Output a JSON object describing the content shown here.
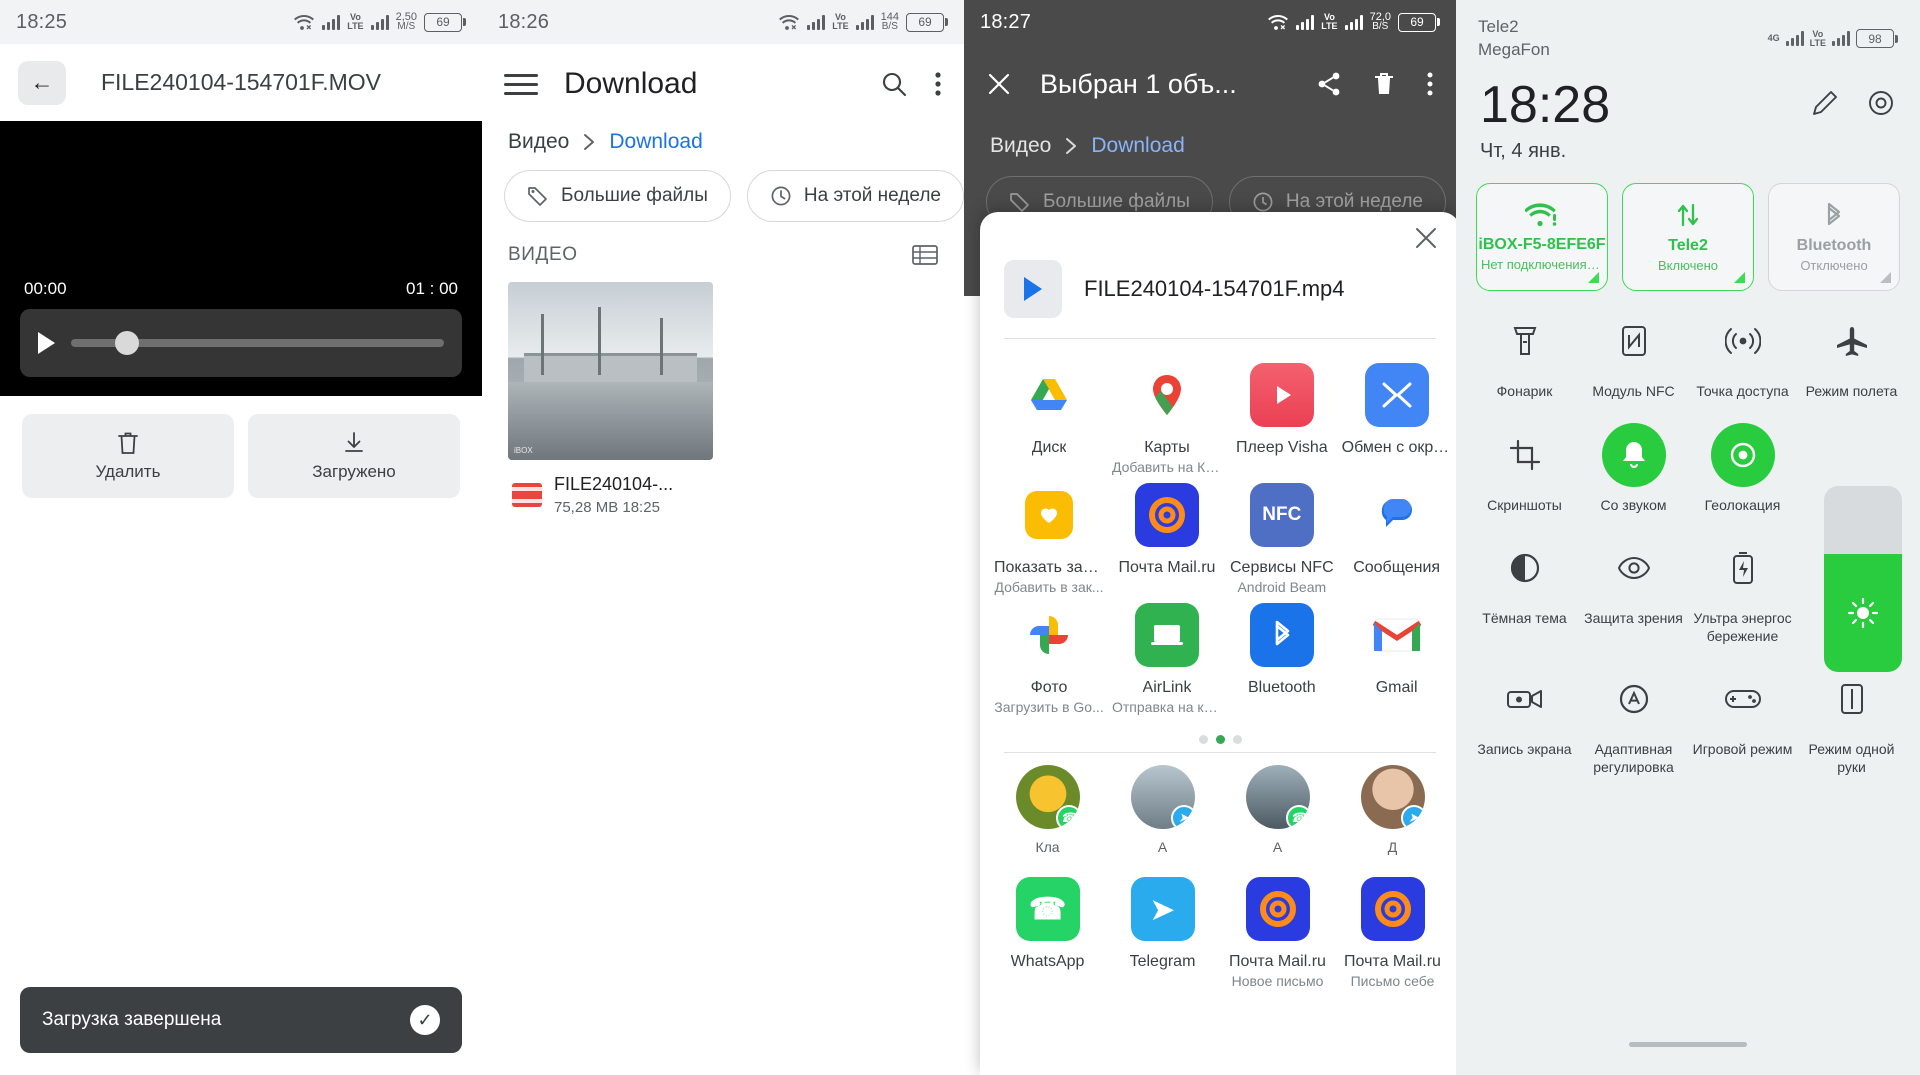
{
  "panel1": {
    "status": {
      "time": "18:25",
      "wifi": "wifi-off-icon",
      "volte": "Vo LTE",
      "netspeed_value": "2,50",
      "netspeed_unit": "M/S",
      "battery": "69"
    },
    "appbar": {
      "back_icon": "arrow-left-icon",
      "title": "FILE240104-154701F.MOV"
    },
    "player": {
      "current_time": "00:00",
      "duration": "01 : 00",
      "play_icon": "play-icon"
    },
    "actions": [
      {
        "icon": "trash-icon",
        "label": "Удалить"
      },
      {
        "icon": "download-icon",
        "label": "Загружено"
      }
    ],
    "snackbar": {
      "text": "Загрузка завершена",
      "icon": "check-circle-icon"
    }
  },
  "panel2": {
    "status": {
      "time": "18:26",
      "volte": "Vo LTE",
      "netspeed_value": "144",
      "netspeed_unit": "B/S",
      "battery": "69"
    },
    "appbar": {
      "menu_icon": "hamburger-icon",
      "title": "Download",
      "search_icon": "search-icon",
      "overflow_icon": "more-vert-icon"
    },
    "breadcrumb": {
      "root": "Видео",
      "sep": "chevron-right-icon",
      "current": "Download"
    },
    "chips": [
      {
        "icon": "tag-icon",
        "label": "Большие файлы"
      },
      {
        "icon": "history-icon",
        "label": "На этой неделе"
      }
    ],
    "section": {
      "header": "ВИДЕО",
      "view_icon": "list-view-icon"
    },
    "file": {
      "name": "FILE240104-...",
      "meta": "75,28 MB 18:25",
      "icon": "video-file-icon"
    }
  },
  "panel3": {
    "status": {
      "time": "18:27",
      "volte": "Vo LTE",
      "netspeed_value": "72,0",
      "netspeed_unit": "B/S",
      "battery": "69"
    },
    "appbar": {
      "close_icon": "close-icon",
      "title": "Выбран 1 объ...",
      "share_icon": "share-icon",
      "delete_icon": "trash-icon",
      "overflow_icon": "more-vert-icon"
    },
    "breadcrumb": {
      "root": "Видео",
      "sep": "chevron-right-icon",
      "current": "Download"
    },
    "chips": [
      {
        "icon": "tag-icon",
        "label": "Большие файлы"
      },
      {
        "icon": "history-icon",
        "label": "На этой неделе"
      }
    ],
    "sheet": {
      "close_icon": "close-icon",
      "file_icon": "play-icon",
      "file_name": "FILE240104-154701F.mp4",
      "apps": [
        {
          "label": "Диск",
          "sub": "",
          "icon": "google-drive-icon"
        },
        {
          "label": "Карты",
          "sub": "Добавить на Ка...",
          "icon": "google-maps-icon"
        },
        {
          "label": "Плеер Visha",
          "sub": "",
          "icon": "visha-player-icon"
        },
        {
          "label": "Обмен с окруже...",
          "sub": "",
          "icon": "nearby-share-icon"
        },
        {
          "label": "Показать заклад...",
          "sub": "Добавить в зак...",
          "icon": "bookmark-heart-icon"
        },
        {
          "label": "Почта Mail.ru",
          "sub": "",
          "icon": "mailru-icon",
          "has_caret": true
        },
        {
          "label": "Сервисы NFC",
          "sub": "Android Beam",
          "icon": "nfc-icon"
        },
        {
          "label": "Сообщения",
          "sub": "",
          "icon": "messages-icon"
        },
        {
          "label": "Фото",
          "sub": "Загрузить в Go...",
          "icon": "google-photos-icon"
        },
        {
          "label": "AirLink",
          "sub": "Отправка на ко...",
          "icon": "airlink-icon"
        },
        {
          "label": "Bluetooth",
          "sub": "",
          "icon": "bluetooth-icon"
        },
        {
          "label": "Gmail",
          "sub": "",
          "icon": "gmail-icon"
        }
      ],
      "pager": {
        "total": 2,
        "active": 0
      },
      "contacts": [
        {
          "name": "Кла",
          "badge": "whatsapp-icon"
        },
        {
          "name": "А",
          "badge": "telegram-icon"
        },
        {
          "name": "А",
          "badge": "whatsapp-icon"
        },
        {
          "name": "Д",
          "badge": "telegram-icon"
        }
      ],
      "bottom_apps": [
        {
          "label": "WhatsApp",
          "sub": "",
          "icon": "whatsapp-icon"
        },
        {
          "label": "Telegram",
          "sub": "",
          "icon": "telegram-icon"
        },
        {
          "label": "Почта Mail.ru",
          "sub": "Новое письмо",
          "icon": "mailru-icon"
        },
        {
          "label": "Почта Mail.ru",
          "sub": "Письмо себе",
          "icon": "mailru-icon"
        }
      ]
    }
  },
  "panel4": {
    "carrier_line1": "Tele2",
    "carrier_line2": "MegaFon",
    "status": {
      "net": "4G",
      "volte": "Vo LTE",
      "battery": "98"
    },
    "clock": "18:28",
    "date": "Чт, 4 янв.",
    "edit_icon": "pencil-icon",
    "settings_icon": "gear-icon",
    "big_tiles": [
      {
        "title": "iBOX-F5-8EFE6F",
        "sub": "Нет подключения к...",
        "icon": "wifi-alert-icon",
        "state": "on"
      },
      {
        "title": "Tele2",
        "sub": "Включено",
        "icon": "data-arrows-icon",
        "state": "on"
      },
      {
        "title": "Bluetooth",
        "sub": "Отключено",
        "icon": "bluetooth-icon",
        "state": "off"
      }
    ],
    "tiles": [
      {
        "label": "Фонарик",
        "icon": "flashlight-icon",
        "active": false
      },
      {
        "label": "Модуль NFC",
        "icon": "nfc-icon",
        "active": false
      },
      {
        "label": "Точка доступа",
        "icon": "hotspot-icon",
        "active": false
      },
      {
        "label": "Режим полета",
        "icon": "airplane-icon",
        "active": false
      },
      {
        "label": "Скриншоты",
        "icon": "screenshot-icon",
        "active": false
      },
      {
        "label": "Со звуком",
        "icon": "bell-icon",
        "active": true
      },
      {
        "label": "Геолокация",
        "icon": "location-icon",
        "active": true
      },
      {
        "label": "",
        "icon": "",
        "active": false
      },
      {
        "label": "Тёмная тема",
        "icon": "dark-theme-icon",
        "active": false
      },
      {
        "label": "Защита зрения",
        "icon": "eye-icon",
        "active": false
      },
      {
        "label": "Ультра энергос бережение",
        "icon": "battery-saver-icon",
        "active": false
      },
      {
        "label": "",
        "icon": "",
        "active": false
      },
      {
        "label": "Запись экрана",
        "icon": "screen-record-icon",
        "active": false
      },
      {
        "label": "Адаптивная регулировка",
        "icon": "adaptive-icon",
        "active": false
      },
      {
        "label": "Игровой режим",
        "icon": "gamepad-icon",
        "active": false
      },
      {
        "label": "Режим одной руки",
        "icon": "one-hand-icon",
        "active": false
      }
    ],
    "brightness": {
      "icon": "sun-icon",
      "level_percent": 63
    }
  }
}
